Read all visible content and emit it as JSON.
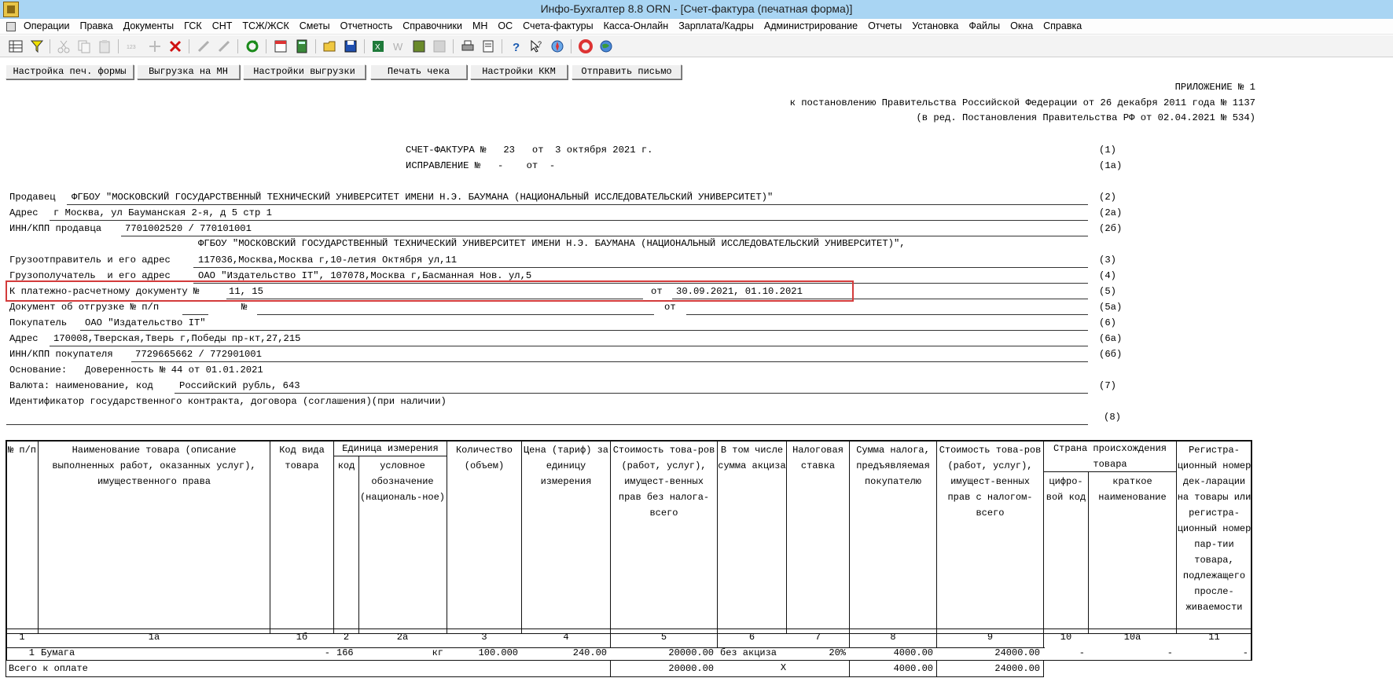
{
  "window": {
    "title": "Инфо-Бухгалтер 8.8   ORN   - [Счет-фактура (печатная форма)]"
  },
  "menu": [
    "Операции",
    "Правка",
    "Документы",
    "ГСК",
    "СНТ",
    "ТСЖ/ЖСК",
    "Сметы",
    "Отчетность",
    "Справочники",
    "МН",
    "ОС",
    "Счета-фактуры",
    "Касса-Онлайн",
    "Зарплата/Кадры",
    "Администрирование",
    "Отчеты",
    "Установка",
    "Файлы",
    "Окна",
    "Справка"
  ],
  "buttons": [
    "Настройка печ. формы",
    "Выгрузка на МН",
    "Настройки выгрузки",
    "Печать чека",
    "Настройки ККМ",
    "Отправить письмо"
  ],
  "header": {
    "line1": "ПРИЛОЖЕНИЕ № 1",
    "line2": "к постановлению Правительства Российской Федерации от 26 декабря 2011 года № 1137",
    "line3": "(в ред. Постановления Правительства РФ от 02.04.2021 № 534)"
  },
  "invoice": {
    "title": "СЧЕТ-ФАКТУРА №   23   от  3 октября 2021 г.",
    "title_code": "(1)",
    "correction": "ИСПРАВЛЕНИЕ №   -    от  -",
    "correction_code": "(1а)"
  },
  "fields": {
    "seller_label": "Продавец",
    "seller_value": "ФГБОУ \"МОСКОВСКИЙ ГОСУДАРСТВЕННЫЙ ТЕХНИЧЕСКИЙ УНИВЕРСИТЕТ ИМЕНИ Н.Э. БАУМАНА (НАЦИОНАЛЬНЫЙ ИССЛЕДОВАТЕЛЬСКИЙ УНИВЕРСИТЕТ)\"",
    "seller_code": "(2)",
    "address_label": "Адрес",
    "address_value": "г Москва, ул Бауманская 2-я, д 5 стр 1",
    "address_code": "(2а)",
    "inn_seller_label": "ИНН/КПП продавца",
    "inn_seller_value": "7701002520 / 770101001",
    "inn_seller_code": "(2б)",
    "shipper_name": "ФГБОУ \"МОСКОВСКИЙ ГОСУДАРСТВЕННЫЙ ТЕХНИЧЕСКИЙ УНИВЕРСИТЕТ ИМЕНИ Н.Э. БАУМАНА (НАЦИОНАЛЬНЫЙ ИССЛЕДОВАТЕЛЬСКИЙ УНИВЕРСИТЕТ)\",",
    "shipper_label": "Грузоотправитель и его адрес",
    "shipper_value": "117036,Москва,Москва г,10-летия Октября ул,11",
    "shipper_code": "(3)",
    "consignee_label": "Грузополучатель  и его адрес",
    "consignee_value": "ОАО \"Издательство IT\", 107078,Москва г,Басманная Нов. ул,5",
    "consignee_code": "(4)",
    "payment_label": "К платежно-расчетному документу №",
    "payment_value": "11, 15",
    "payment_from": "от",
    "payment_date": "30.09.2021, 01.10.2021",
    "payment_code": "(5)",
    "shipdoc_label": "Документ об отгрузке № п/п",
    "shipdoc_no": "№",
    "shipdoc_from": "от",
    "shipdoc_code": "(5а)",
    "buyer_label": "Покупатель",
    "buyer_value": "ОАО \"Издательство IT\"",
    "buyer_code": "(6)",
    "buyer_address_label": "Адрес",
    "buyer_address_value": "170008,Тверская,Тверь г,Победы пр-кт,27,215",
    "buyer_address_code": "(6а)",
    "inn_buyer_label": "ИНН/КПП покупателя",
    "inn_buyer_value": "7729665662 / 772901001",
    "inn_buyer_code": "(6б)",
    "basis_label": "Основание:",
    "basis_value": "Доверенность № 44 от 01.01.2021",
    "currency_label": "Валюта: наименование, код",
    "currency_value": "Российский рубль, 643",
    "currency_code": "(7)",
    "contract_label": "Идентификатор государственного контракта, договора (соглашения)(при наличии)",
    "contract_code": "(8)"
  },
  "table": {
    "h_no": "№ п/п",
    "h_name": "Наименование товара (описание выполненных работ, оказанных услуг), имущественного права",
    "h_kind": "Код вида товара",
    "h_unit": "Единица измерения",
    "h_unit_code": "код",
    "h_unit_name": "условное обозначение (националь-ное)",
    "h_qty": "Количество (объем)",
    "h_price": "Цена (тариф) за единицу измерения",
    "h_cost": "Стоимость това-ров (работ, услуг), имущест-венных прав без налога-всего",
    "h_excise": "В том числе сумма акциза",
    "h_rate": "Налоговая ставка",
    "h_tax": "Сумма налога, предъявляемая покупателю",
    "h_total": "Стоимость това-ров (работ, услуг), имущест-венных прав с налогом-всего",
    "h_country": "Страна происхождения товара",
    "h_country_code": "цифро-вой код",
    "h_country_name": "краткое наименование",
    "h_reg": "Регистра-ционный номер дек-ларации на товары или регистра-ционный номер пар-тии товара, подлежащего просле-живаемости",
    "nums": [
      "1",
      "1а",
      "1б",
      "2",
      "2а",
      "3",
      "4",
      "5",
      "6",
      "7",
      "8",
      "9",
      "10",
      "10а",
      "11"
    ],
    "row": {
      "no": "1",
      "name": "Бумага",
      "kind": "-",
      "unit_code": "166",
      "unit_name": "кг",
      "qty": "100.000",
      "price": "240.00",
      "cost": "20000.00",
      "excise": "без акциза",
      "rate": "20%",
      "tax": "4000.00",
      "total": "24000.00",
      "country_code": "-",
      "country_name": "-",
      "reg": "-"
    },
    "total_label": "Всего к оплате",
    "total_cost": "20000.00",
    "total_x": "X",
    "total_tax": "4000.00",
    "total_sum": "24000.00"
  }
}
